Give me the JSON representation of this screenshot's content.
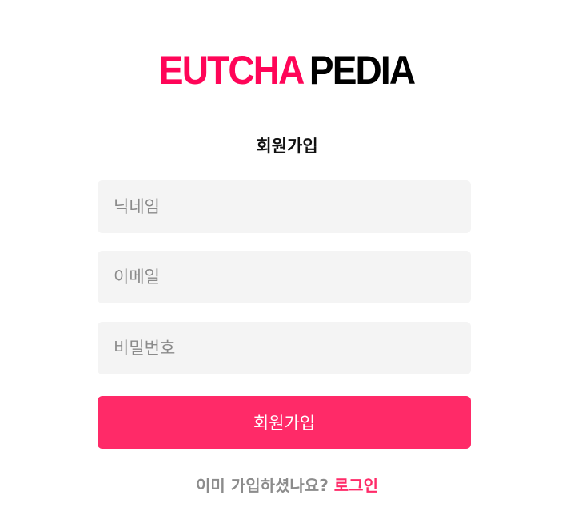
{
  "logo": {
    "accent": "EUTCHA",
    "rest": "PEDIA"
  },
  "page_title": "회원가입",
  "form": {
    "nickname_placeholder": "닉네임",
    "email_placeholder": "이메일",
    "password_placeholder": "비밀번호",
    "submit_label": "회원가입"
  },
  "footer": {
    "prompt": "이미 가입하셨나요?",
    "login_link": "로그인"
  },
  "colors": {
    "brand_accent": "#ff0558",
    "button": "#ff2a68",
    "field_background": "#f4f4f4"
  }
}
